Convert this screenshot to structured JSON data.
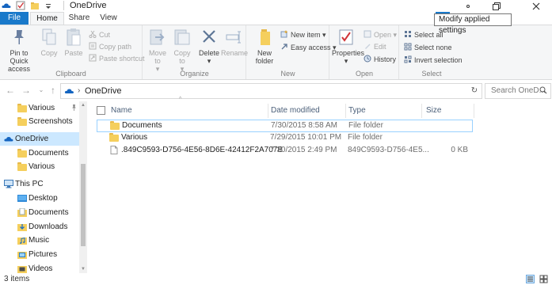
{
  "window": {
    "title": "OneDrive",
    "tooltip": "Modify applied settings"
  },
  "tabs": [
    {
      "label": "File"
    },
    {
      "label": "Home"
    },
    {
      "label": "Share"
    },
    {
      "label": "View"
    }
  ],
  "ribbon": {
    "clipboard": {
      "label": "Clipboard",
      "pin": "Pin to Quick access",
      "copy": "Copy",
      "paste": "Paste",
      "cut": "Cut",
      "copy_path": "Copy path",
      "paste_shortcut": "Paste shortcut"
    },
    "organize": {
      "label": "Organize",
      "move_to": "Move to",
      "copy_to": "Copy to",
      "delete": "Delete",
      "rename": "Rename"
    },
    "new": {
      "label": "New",
      "new_folder": "New folder",
      "new_item": "New item",
      "easy_access": "Easy access"
    },
    "open": {
      "label": "Open",
      "properties": "Properties",
      "open": "Open",
      "edit": "Edit",
      "history": "History"
    },
    "select": {
      "label": "Select",
      "select_all": "Select all",
      "select_none": "Select none",
      "invert_selection": "Invert selection"
    }
  },
  "address": {
    "current": "OneDrive",
    "search_placeholder": "Search OneD..."
  },
  "nav": {
    "items": [
      {
        "label": "Various",
        "icon": "folder-icon"
      },
      {
        "label": "Screenshots",
        "icon": "folder-icon"
      },
      {
        "label": "OneDrive",
        "icon": "cloud-icon"
      },
      {
        "label": "Documents",
        "icon": "folder-icon"
      },
      {
        "label": "Various",
        "icon": "folder-icon"
      },
      {
        "label": "This PC",
        "icon": "computer-icon"
      },
      {
        "label": "Desktop",
        "icon": "folder-icon"
      },
      {
        "label": "Documents",
        "icon": "folder-icon"
      },
      {
        "label": "Downloads",
        "icon": "folder-icon"
      },
      {
        "label": "Music",
        "icon": "folder-icon"
      },
      {
        "label": "Pictures",
        "icon": "folder-icon"
      },
      {
        "label": "Videos",
        "icon": "folder-icon"
      }
    ]
  },
  "columns": {
    "name": "Name",
    "date": "Date modified",
    "type": "Type",
    "size": "Size"
  },
  "files": [
    {
      "name": "Documents",
      "date": "7/30/2015 8:58 AM",
      "type": "File folder",
      "size": ""
    },
    {
      "name": "Various",
      "date": "7/29/2015 10:01 PM",
      "type": "File folder",
      "size": ""
    },
    {
      "name": ".849C9593-D756-4E56-8D6E-42412F2A707B",
      "date": "7/30/2015 2:49 PM",
      "type": "849C9593-D756-4E5...",
      "size": "0 KB"
    }
  ],
  "status": {
    "count": "3 items"
  },
  "colors": {
    "accent": "#1979ca",
    "selection": "#cce8ff",
    "folder": "#f5cf5d"
  }
}
